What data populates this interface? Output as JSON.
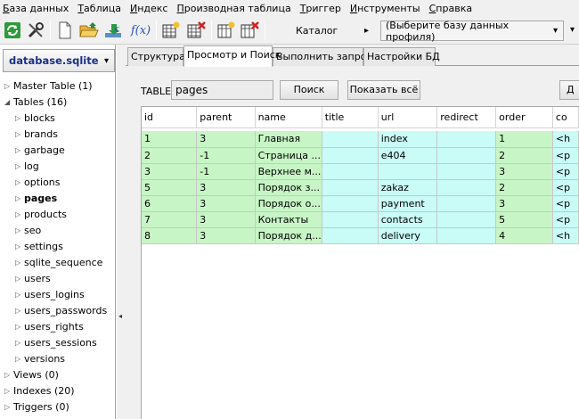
{
  "menu": [
    "База данных",
    "Таблица",
    "Индекс",
    "Производная таблица",
    "Триггер",
    "Инструменты",
    "Справка"
  ],
  "toolbar": {
    "catalog_label": "Каталог",
    "catalog_arrow": "▸",
    "profile_combo_value": "(Выберите базу данных профиля)",
    "combo_arrow": "▾",
    "fx_label": "f(x)"
  },
  "sidebar": {
    "db_name": "database.sqlite",
    "tree": [
      {
        "label": "Master Table (1)",
        "level": 0,
        "arrow": "▷",
        "bold": false
      },
      {
        "label": "Tables (16)",
        "level": 0,
        "arrow": "◢",
        "bold": false
      },
      {
        "label": "blocks",
        "level": 1,
        "arrow": "▷",
        "bold": false
      },
      {
        "label": "brands",
        "level": 1,
        "arrow": "▷",
        "bold": false
      },
      {
        "label": "garbage",
        "level": 1,
        "arrow": "▷",
        "bold": false
      },
      {
        "label": "log",
        "level": 1,
        "arrow": "▷",
        "bold": false
      },
      {
        "label": "options",
        "level": 1,
        "arrow": "▷",
        "bold": false
      },
      {
        "label": "pages",
        "level": 1,
        "arrow": "▷",
        "bold": true
      },
      {
        "label": "products",
        "level": 1,
        "arrow": "▷",
        "bold": false
      },
      {
        "label": "seo",
        "level": 1,
        "arrow": "▷",
        "bold": false
      },
      {
        "label": "settings",
        "level": 1,
        "arrow": "▷",
        "bold": false
      },
      {
        "label": "sqlite_sequence",
        "level": 1,
        "arrow": "▷",
        "bold": false
      },
      {
        "label": "users",
        "level": 1,
        "arrow": "▷",
        "bold": false
      },
      {
        "label": "users_logins",
        "level": 1,
        "arrow": "▷",
        "bold": false
      },
      {
        "label": "users_passwords",
        "level": 1,
        "arrow": "▷",
        "bold": false
      },
      {
        "label": "users_rights",
        "level": 1,
        "arrow": "▷",
        "bold": false
      },
      {
        "label": "users_sessions",
        "level": 1,
        "arrow": "▷",
        "bold": false
      },
      {
        "label": "versions",
        "level": 1,
        "arrow": "▷",
        "bold": false
      },
      {
        "label": "Views (0)",
        "level": 0,
        "arrow": "▷",
        "bold": false
      },
      {
        "label": "Indexes (20)",
        "level": 0,
        "arrow": "▷",
        "bold": false
      },
      {
        "label": "Triggers (0)",
        "level": 0,
        "arrow": "▷",
        "bold": false
      }
    ]
  },
  "tabs": [
    "Структура",
    "Просмотр и Поиск",
    "Выполнить запрос",
    "Настройки БД"
  ],
  "active_tab": 1,
  "browse": {
    "table_label": "TABLE",
    "table_value": "pages",
    "search_button": "Поиск",
    "show_all_button": "Показать всё",
    "edge_button": "Д"
  },
  "grid": {
    "columns": [
      "id",
      "parent",
      "name",
      "title",
      "url",
      "redirect",
      "order",
      "co"
    ],
    "rows": [
      [
        "1",
        "3",
        "Главная",
        "",
        "index",
        "",
        "1",
        "<h"
      ],
      [
        "2",
        "-1",
        "Страница ...",
        "",
        "e404",
        "",
        "2",
        "<p"
      ],
      [
        "3",
        "-1",
        "Верхнее м...",
        "",
        "",
        "",
        "3",
        "<p"
      ],
      [
        "5",
        "3",
        "Порядок з...",
        "",
        "zakaz",
        "",
        "2",
        "<p"
      ],
      [
        "6",
        "3",
        "Порядок о...",
        "",
        "payment",
        "",
        "3",
        "<p"
      ],
      [
        "7",
        "3",
        "Контакты",
        "",
        "contacts",
        "",
        "5",
        "<p"
      ],
      [
        "8",
        "3",
        "Порядок д...",
        "",
        "delivery",
        "",
        "4",
        "<h"
      ]
    ],
    "row_highlight_color": "#c7f5c5",
    "row_base_color": "#c9fbf7"
  }
}
